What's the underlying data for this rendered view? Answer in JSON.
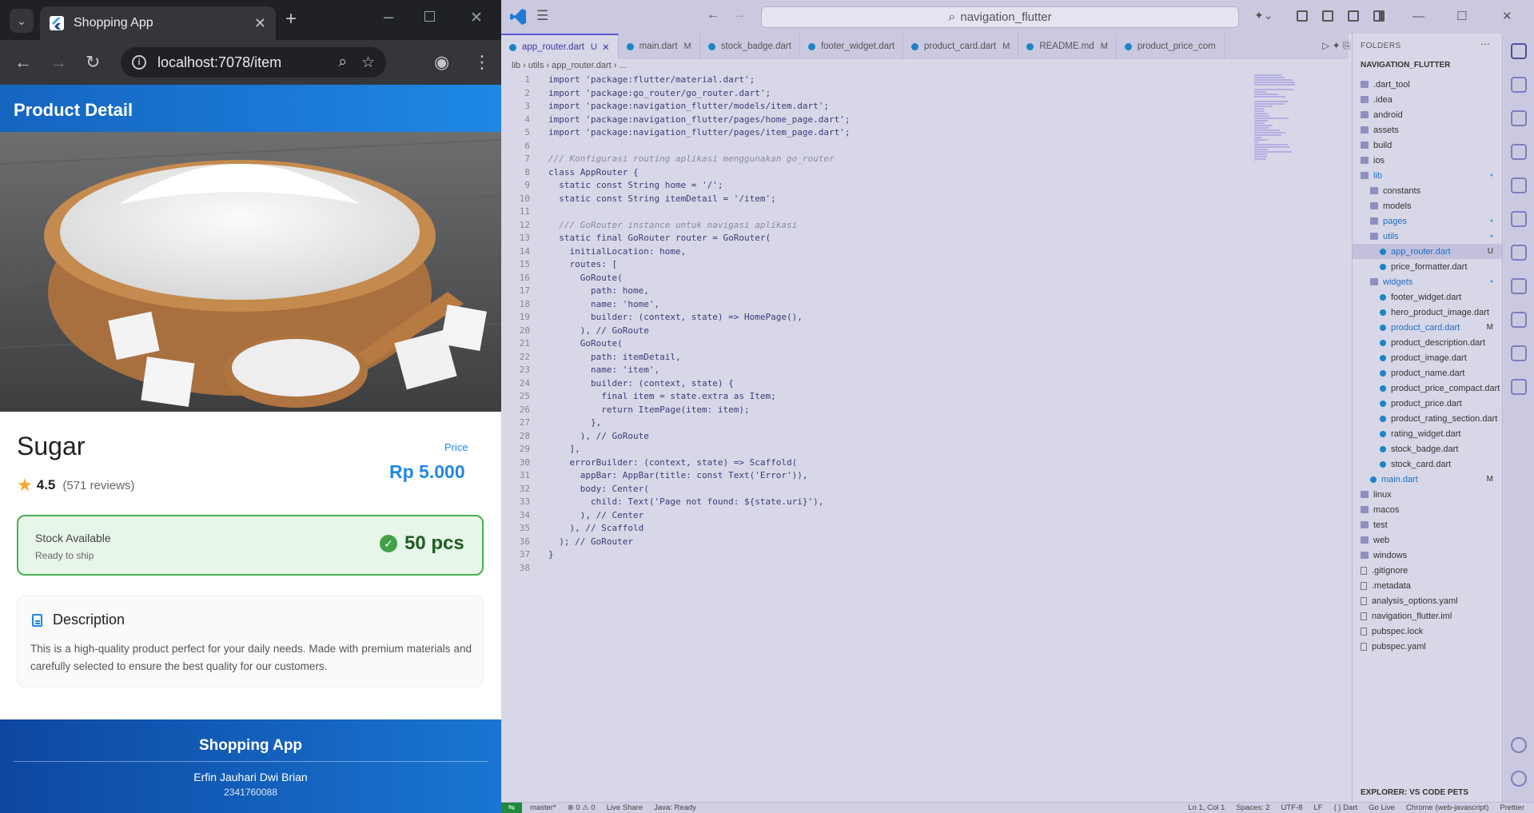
{
  "browser": {
    "tab_title": "Shopping App",
    "url": "localhost:7078/item"
  },
  "app": {
    "appbar_title": "Product Detail",
    "product_name": "Sugar",
    "rating": "4.5",
    "reviews": "(571 reviews)",
    "price_label": "Price",
    "price": "Rp 5.000",
    "stock_title": "Stock Available",
    "stock_subtitle": "Ready to ship",
    "stock_qty": "50 pcs",
    "description_title": "Description",
    "description_text": "This is a high-quality product perfect for your daily needs. Made with premium materials and carefully selected to ensure the best quality for our customers.",
    "footer_title": "Shopping App",
    "footer_author": "Erfin Jauhari Dwi Brian",
    "footer_nim": "2341760088",
    "colors": {
      "primary": "#1e88e5",
      "stock_green": "#43a047",
      "star": "#f9a825"
    }
  },
  "vscode": {
    "search": "navigation_flutter",
    "tabs": [
      {
        "label": "app_router.dart",
        "mod": "U",
        "active": true
      },
      {
        "label": "main.dart",
        "mod": "M"
      },
      {
        "label": "stock_badge.dart",
        "mod": ""
      },
      {
        "label": "footer_widget.dart",
        "mod": ""
      },
      {
        "label": "product_card.dart",
        "mod": "M"
      },
      {
        "label": "README.md",
        "mod": "M"
      },
      {
        "label": "product_price_com",
        "mod": ""
      }
    ],
    "breadcrumb": "lib  ›  utils  ›  app_router.dart  ›  ...",
    "code": [
      "import 'package:flutter/material.dart';",
      "import 'package:go_router/go_router.dart';",
      "import 'package:navigation_flutter/models/item.dart';",
      "import 'package:navigation_flutter/pages/home_page.dart';",
      "import 'package:navigation_flutter/pages/item_page.dart';",
      "",
      "/// Konfigurasi routing aplikasi menggunakan go_router",
      "class AppRouter {",
      "  static const String home = '/';",
      "  static const String itemDetail = '/item';",
      "",
      "  /// GoRouter instance untuk navigasi aplikasi",
      "  static final GoRouter router = GoRouter(",
      "    initialLocation: home,",
      "    routes: [",
      "      GoRoute(",
      "        path: home,",
      "        name: 'home',",
      "        builder: (context, state) => HomePage(),",
      "      ), // GoRoute",
      "      GoRoute(",
      "        path: itemDetail,",
      "        name: 'item',",
      "        builder: (context, state) {",
      "          final item = state.extra as Item;",
      "          return ItemPage(item: item);",
      "        },",
      "      ), // GoRoute",
      "    ],",
      "    errorBuilder: (context, state) => Scaffold(",
      "      appBar: AppBar(title: const Text('Error')),",
      "      body: Center(",
      "        child: Text('Page not found: ${state.uri}'),",
      "      ), // Center",
      "    ), // Scaffold",
      "  ); // GoRouter",
      "}",
      ""
    ],
    "sidebar_header": "FOLDERS",
    "root_folder": "NAVIGATION_FLUTTER",
    "tree": [
      {
        "label": ".dart_tool",
        "type": "folder",
        "indent": 0
      },
      {
        "label": ".idea",
        "type": "folder",
        "indent": 0
      },
      {
        "label": "android",
        "type": "folder",
        "indent": 0
      },
      {
        "label": "assets",
        "type": "folder",
        "indent": 0
      },
      {
        "label": "build",
        "type": "folder",
        "indent": 0
      },
      {
        "label": "ios",
        "type": "folder",
        "indent": 0
      },
      {
        "label": "lib",
        "type": "folder",
        "indent": 0,
        "dot": true
      },
      {
        "label": "constants",
        "type": "folder",
        "indent": 1
      },
      {
        "label": "models",
        "type": "folder",
        "indent": 1
      },
      {
        "label": "pages",
        "type": "folder",
        "indent": 1,
        "dot": true
      },
      {
        "label": "utils",
        "type": "folder",
        "indent": 1,
        "dot": true
      },
      {
        "label": "app_router.dart",
        "type": "dart",
        "indent": 2,
        "badge": "U",
        "selected": true
      },
      {
        "label": "price_formatter.dart",
        "type": "dart",
        "indent": 2
      },
      {
        "label": "widgets",
        "type": "folder",
        "indent": 1,
        "dot": true
      },
      {
        "label": "footer_widget.dart",
        "type": "dart",
        "indent": 2
      },
      {
        "label": "hero_product_image.dart",
        "type": "dart",
        "indent": 2
      },
      {
        "label": "product_card.dart",
        "type": "dart",
        "indent": 2,
        "badge": "M"
      },
      {
        "label": "product_description.dart",
        "type": "dart",
        "indent": 2
      },
      {
        "label": "product_image.dart",
        "type": "dart",
        "indent": 2
      },
      {
        "label": "product_name.dart",
        "type": "dart",
        "indent": 2
      },
      {
        "label": "product_price_compact.dart",
        "type": "dart",
        "indent": 2
      },
      {
        "label": "product_price.dart",
        "type": "dart",
        "indent": 2
      },
      {
        "label": "product_rating_section.dart",
        "type": "dart",
        "indent": 2
      },
      {
        "label": "rating_widget.dart",
        "type": "dart",
        "indent": 2
      },
      {
        "label": "stock_badge.dart",
        "type": "dart",
        "indent": 2
      },
      {
        "label": "stock_card.dart",
        "type": "dart",
        "indent": 2
      },
      {
        "label": "main.dart",
        "type": "dart",
        "indent": 1,
        "badge": "M"
      },
      {
        "label": "linux",
        "type": "folder",
        "indent": 0
      },
      {
        "label": "macos",
        "type": "folder",
        "indent": 0
      },
      {
        "label": "test",
        "type": "folder",
        "indent": 0
      },
      {
        "label": "web",
        "type": "folder",
        "indent": 0
      },
      {
        "label": "windows",
        "type": "folder",
        "indent": 0
      },
      {
        "label": ".gitignore",
        "type": "file",
        "indent": 0
      },
      {
        "label": ".metadata",
        "type": "file",
        "indent": 0
      },
      {
        "label": "analysis_options.yaml",
        "type": "file",
        "indent": 0
      },
      {
        "label": "navigation_flutter.iml",
        "type": "file",
        "indent": 0
      },
      {
        "label": "pubspec.lock",
        "type": "file",
        "indent": 0
      },
      {
        "label": "pubspec.yaml",
        "type": "file",
        "indent": 0
      }
    ],
    "sidebar_footer": "EXPLORER: VS CODE PETS",
    "status_left": [
      "master*",
      "⊗ 0 ⚠ 0",
      "Live Share",
      "Java: Ready"
    ],
    "status_right": [
      "Ln 1, Col 1",
      "Spaces: 2",
      "UTF-8",
      "LF",
      "{ } Dart",
      "Go Live",
      "Chrome (web-javascript)",
      "Prettier"
    ]
  }
}
